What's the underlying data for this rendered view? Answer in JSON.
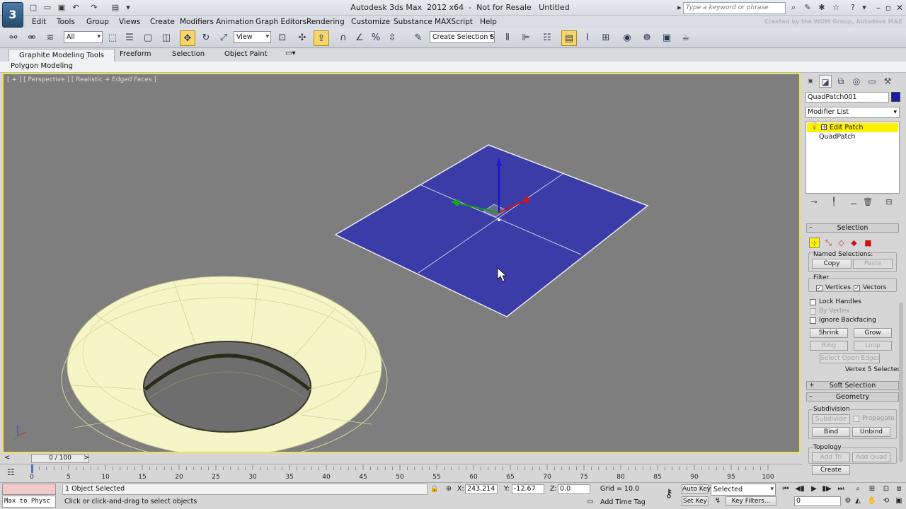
{
  "app": {
    "title": "Autodesk 3ds Max  2012 x64  -  Not for Resale   Untitled",
    "search_placeholder": "Type a keyword or phrase",
    "logo_text": "3"
  },
  "menu": [
    "Edit",
    "Tools",
    "Group",
    "Views",
    "Create",
    "Modifiers",
    "Animation",
    "Graph Editors",
    "Rendering",
    "Customize",
    "Substance",
    "MAXScript",
    "Help"
  ],
  "toolbar": {
    "selection_filter": "All",
    "ref_coord": "View",
    "named_selection_placeholder": "Create Selection Se"
  },
  "credit_text": "Created by the WOM Group, Autodesk M&E",
  "ribbon": {
    "tabs": [
      "Graphite Modeling Tools",
      "Freeform",
      "Selection",
      "Object Paint"
    ],
    "active_tab": "Graphite Modeling Tools",
    "sub_label": "Polygon Modeling"
  },
  "viewport": {
    "label": "[ + ] [ Perspective ] [ Realistic + Edged Faces ]",
    "colors": {
      "background": "#7e7e7e",
      "patch": "#3c3ca8",
      "torus": "#f5f5c8",
      "border": "#f0e14a"
    }
  },
  "command_panel": {
    "object_name": "QuadPatch001",
    "object_color": "#1919a8",
    "modifier_list": "Modifier List",
    "stack": [
      "Edit Patch",
      "QuadPatch"
    ],
    "selection": {
      "title": "Selection",
      "named_selections": "Named Selections:",
      "copy": "Copy",
      "paste": "Paste",
      "filter": "Filter",
      "vertices": "Vertices",
      "vectors": "Vectors",
      "lock_handles": "Lock Handles",
      "by_vertex": "By Vertex",
      "ignore_backfacing": "Ignore Backfacing",
      "shrink": "Shrink",
      "grow": "Grow",
      "ring": "Ring",
      "loop": "Loop",
      "select_open_edges": "Select Open Edges",
      "status": "Vertex 5 Selected"
    },
    "soft_selection": "Soft Selection",
    "geometry": {
      "title": "Geometry",
      "subdivision": "Subdivision",
      "subdivide": "Subdivide",
      "propagate": "Propagate",
      "bind": "Bind",
      "unbind": "Unbind",
      "topology": "Topology",
      "add_tri": "Add Tri",
      "add_quad": "Add Quad",
      "create": "Create"
    }
  },
  "timeline": {
    "slider": "0 / 100",
    "ticks": [
      0,
      5,
      10,
      15,
      20,
      25,
      30,
      35,
      40,
      45,
      50,
      55,
      60,
      65,
      70,
      75,
      80,
      85,
      90,
      95,
      100
    ]
  },
  "status": {
    "maxscript": "Max to Physc",
    "selection_info": "1 Object Selected",
    "prompt": "Click or click-and-drag to select objects",
    "x_label": "X:",
    "x": "243.214",
    "y_label": "Y:",
    "y": "-12.67",
    "z_label": "Z:",
    "z": "0.0",
    "grid": "Grid = 10.0",
    "add_time_tag": "Add Time Tag",
    "auto_key": "Auto Key",
    "set_key": "Set Key",
    "selected": "Selected",
    "key_filters": "Key Filters...",
    "frame": "0"
  }
}
